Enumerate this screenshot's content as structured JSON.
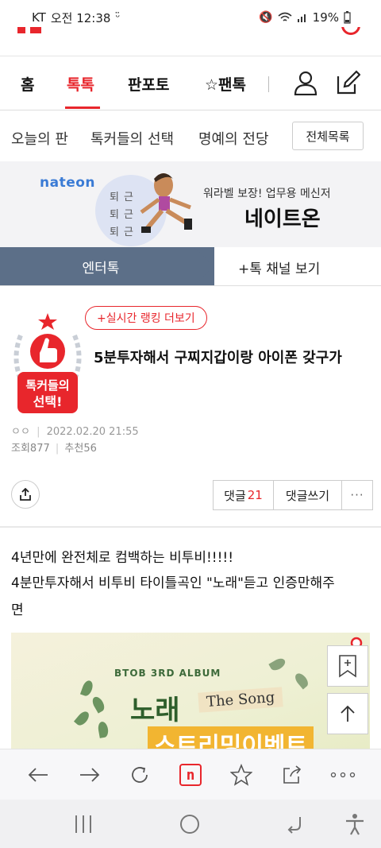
{
  "status_bar": {
    "carrier": "KT",
    "time": "오전 12:38",
    "battery": "19%"
  },
  "main_nav": {
    "items": [
      "홈",
      "톡톡",
      "판포토",
      "팬톡"
    ],
    "active": "톡톡"
  },
  "sub_nav": {
    "items": [
      "오늘의 판",
      "톡커들의 선택",
      "명예의 전당"
    ],
    "all_button": "전체목록"
  },
  "banner": {
    "brand": "nateon",
    "moon_text": [
      "퇴근",
      "퇴근",
      "퇴근"
    ],
    "subtitle": "워라벨 보장! 업무용 메신저",
    "title": "네이트온"
  },
  "tabs": {
    "active": "엔터톡",
    "other": "+톡 채널 보기"
  },
  "post": {
    "badge_label": "톡커들의\n선택!",
    "ranking_link": "+실시간 랭킹 더보기",
    "title": "5분투자해서 구찌지갑이랑 아이폰 갖구가",
    "author": "ㅇㅇ",
    "date": "2022.02.20 21:55",
    "views_label": "조회",
    "views": "877",
    "recommend_label": "추천",
    "recommend": "56",
    "comment_label": "댓글",
    "comment_count": "21",
    "write_comment": "댓글쓰기",
    "body_lines": [
      "4년만에 완전체로 컴백하는 비투비!!!!!",
      "4분만투자해서 비투비 타이틀곡인 \"노래\"듣고 인증만해주",
      "면"
    ],
    "poster": {
      "subtitle": "BTOB 3RD ALBUM",
      "title": "노래",
      "song": "The Song",
      "event": "스트리밍이벤트"
    }
  },
  "colors": {
    "accent": "#e8262c",
    "tab_active_bg": "#5c6f88",
    "banner_bg": "#f3f3f5"
  }
}
